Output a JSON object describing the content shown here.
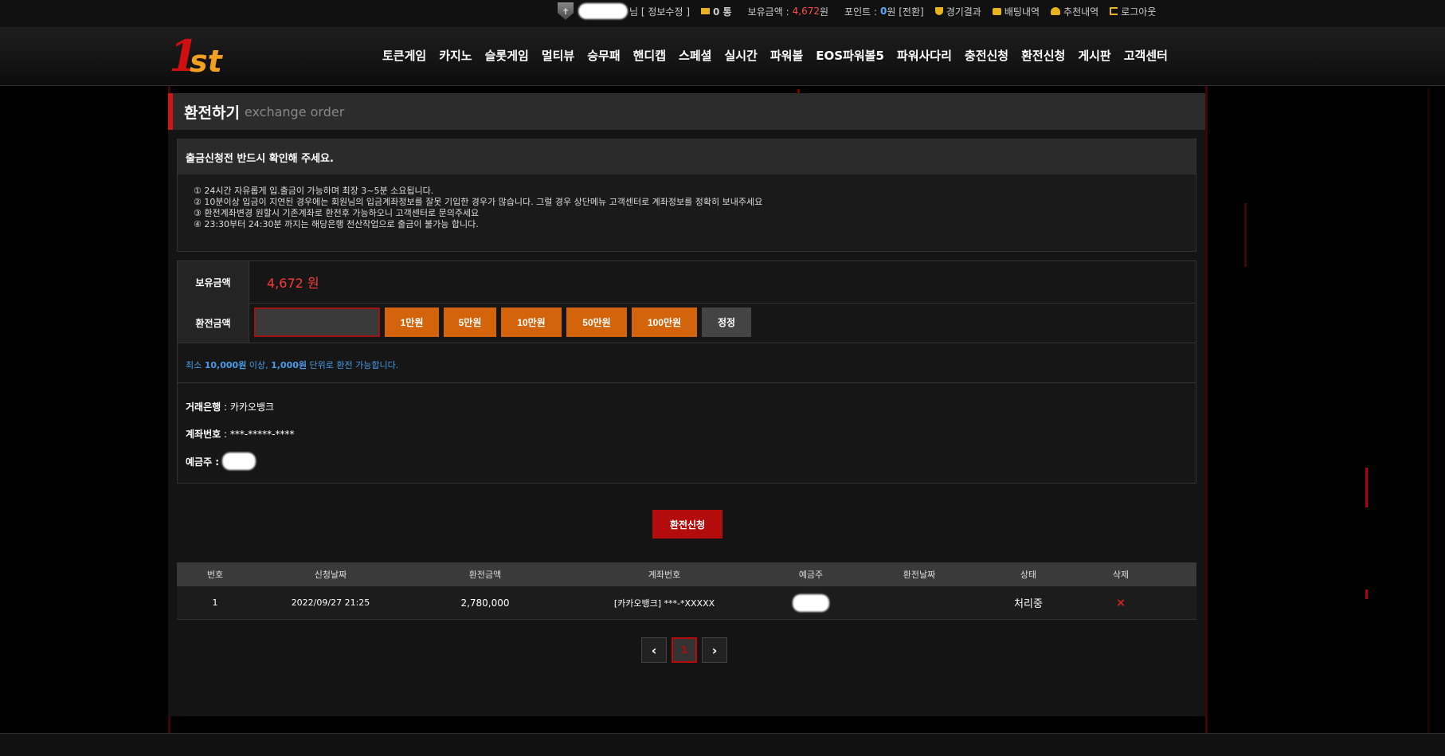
{
  "topbar": {
    "user_suffix": "님 [ 정보수정 ]",
    "messages": "0 통",
    "balance_label": "보유금액 :",
    "balance_value": "4,672",
    "balance_unit": "원",
    "point_label": "포인트 :",
    "point_value": "0",
    "point_unit": "원 [전환]",
    "links": [
      "경기결과",
      "배팅내역",
      "추천내역",
      "로그아웃"
    ]
  },
  "nav": {
    "items": [
      "토큰게임",
      "카지노",
      "슬롯게임",
      "멀티뷰",
      "승무패",
      "핸디캡",
      "스페셜",
      "실시간",
      "파워볼",
      "EOS파워볼5",
      "파워사다리",
      "충전신청",
      "환전신청",
      "게시판",
      "고객센터"
    ]
  },
  "page": {
    "title": "환전하기",
    "subtitle": "exchange order"
  },
  "notice": {
    "heading": "출금신청전 반드시 확인해 주세요.",
    "lines": [
      "① 24시간 자유롭게 입.출금이 가능하며 최장 3~5분 소요됩니다.",
      "② 10분이상 입금이 지연된 경우에는 회원님의 입금계좌정보를 잘못 기입한 경우가 많습니다. 그럴 경우 상단메뉴 고객센터로 계좌정보를 정확히 보내주세요",
      "③ 환전계좌변경 원할시 기존계좌로 환전후 가능하오니 고객센터로 문의주세요",
      "④ 23:30부터 24:30분 까지는 해당은행 전산작업으로 출금이 불가능 합니다."
    ]
  },
  "form": {
    "balance_label": "보유금액",
    "balance_value": "4,672 원",
    "amount_label": "환전금액",
    "amount_value": "",
    "quick_buttons": [
      "1만원",
      "5만원",
      "10만원",
      "50만원",
      "100만원"
    ],
    "reset_button": "정정",
    "min_note_pre": "최소",
    "min_amount": "10,000원",
    "min_note_mid": "이상,",
    "unit_amount": "1,000원",
    "min_note_post": "단위로 환전 가능합니다.",
    "bank_label": "거래은행",
    "bank_value": " : 카카오뱅크",
    "account_label": "계좌번호",
    "account_value": " : ***-*****-****",
    "holder_label": "예금주 :"
  },
  "submit_label": "환전신청",
  "table": {
    "headers": [
      "번호",
      "신청날짜",
      "환전금액",
      "계좌번호",
      "예금주",
      "환전날짜",
      "상태",
      "삭제"
    ],
    "rows": [
      {
        "no": "1",
        "date": "2022/09/27 21:25",
        "amount": "2,780,000",
        "account": "[카카오뱅크] ***-*XXXXX",
        "paid_date": "",
        "status": "처리중",
        "delete": "×"
      }
    ]
  },
  "pager": {
    "prev": "‹",
    "current": "1",
    "next": "›"
  }
}
